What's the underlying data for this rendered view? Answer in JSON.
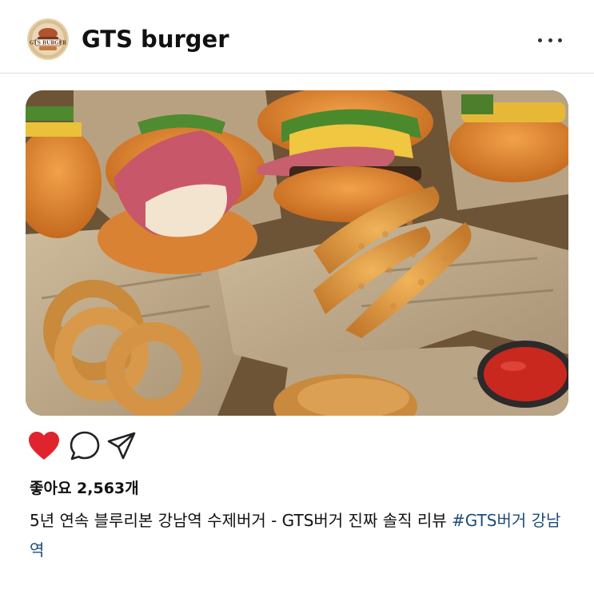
{
  "post": {
    "username": "GTS burger",
    "avatar_text": "GTS BURGER",
    "likes_text": "좋아요 2,563개",
    "caption_text": "5년 연속 블루리본 강남역 수제버거 - GTS버거 진짜 솔직 리뷰 ",
    "hashtag_text": "#GTS버거 강남역",
    "liked": true
  },
  "icons": {
    "avatar": "gts-burger-logo",
    "more": "more-dots-icon",
    "like": "heart-icon",
    "comment": "comment-icon",
    "share": "share-icon"
  },
  "colors": {
    "like_red": "#e0242e",
    "hashtag_blue": "#1e4c7a",
    "divider": "#dcdcdc"
  }
}
